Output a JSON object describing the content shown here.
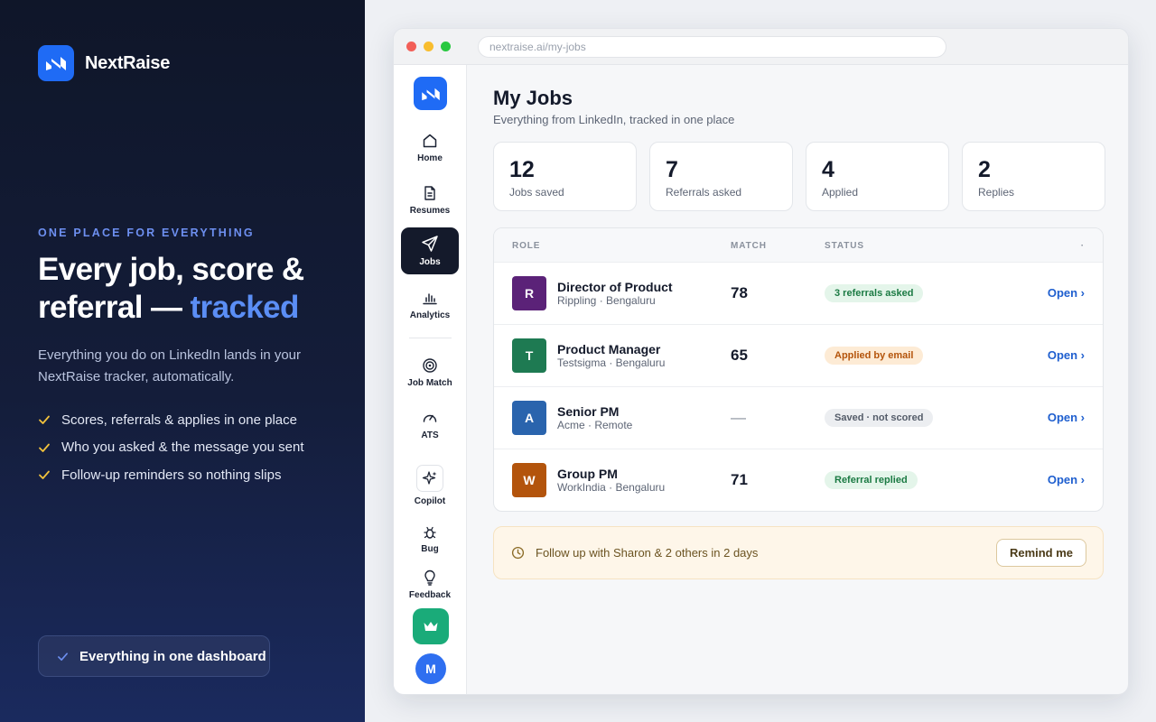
{
  "brand": {
    "name": "NextRaise"
  },
  "hero": {
    "eyebrow": "ONE PLACE FOR EVERYTHING",
    "headline_main": "Every job, score & referral — ",
    "headline_accent": "tracked",
    "lede": "Everything you do on LinkedIn lands in your NextRaise tracker, automatically.",
    "bullets": [
      "Scores, referrals & applies in one place",
      "Who you asked & the message you sent",
      "Follow-up reminders so nothing slips"
    ],
    "badge": "Everything in one dashboard"
  },
  "browser": {
    "url": "nextraise.ai/my-jobs"
  },
  "sidebar": {
    "items": [
      {
        "label": "Home",
        "icon": "home-icon"
      },
      {
        "label": "Resumes",
        "icon": "document-icon"
      },
      {
        "label": "Jobs",
        "icon": "send-icon",
        "active": true
      },
      {
        "label": "Analytics",
        "icon": "bar-chart-icon"
      },
      {
        "label": "Job Match",
        "icon": "target-icon"
      },
      {
        "label": "ATS",
        "icon": "gauge-icon"
      },
      {
        "label": "Copilot",
        "icon": "sparkle-icon"
      },
      {
        "label": "Bug",
        "icon": "bug-icon"
      },
      {
        "label": "Feedback",
        "icon": "lightbulb-icon"
      }
    ],
    "upgrade_icon": "crown-icon",
    "avatar_initial": "M"
  },
  "page": {
    "title": "My Jobs",
    "subtitle": "Everything from LinkedIn, tracked in one place"
  },
  "stats": [
    {
      "value": "12",
      "label": "Jobs saved"
    },
    {
      "value": "7",
      "label": "Referrals asked"
    },
    {
      "value": "4",
      "label": "Applied"
    },
    {
      "value": "2",
      "label": "Replies"
    }
  ],
  "table": {
    "headers": {
      "role": "ROLE",
      "match": "MATCH",
      "status": "STATUS",
      "action": "·"
    },
    "rows": [
      {
        "initial": "R",
        "logo_color": "#5b2278",
        "title": "Director of Product",
        "company": "Rippling · Bengaluru",
        "match": "78",
        "status": "3 referrals asked",
        "status_tone": "green",
        "action": "Open ›"
      },
      {
        "initial": "T",
        "logo_color": "#1e7a52",
        "title": "Product Manager",
        "company": "Testsigma · Bengaluru",
        "match": "65",
        "status": "Applied by email",
        "status_tone": "amber",
        "action": "Open ›"
      },
      {
        "initial": "A",
        "logo_color": "#2a64ad",
        "title": "Senior PM",
        "company": "Acme · Remote",
        "match": "—",
        "status": "Saved · not scored",
        "status_tone": "gray",
        "action": "Open ›"
      },
      {
        "initial": "W",
        "logo_color": "#b3540c",
        "title": "Group PM",
        "company": "WorkIndia · Bengaluru",
        "match": "71",
        "status": "Referral replied",
        "status_tone": "green",
        "action": "Open ›"
      }
    ]
  },
  "reminder": {
    "text": "Follow up with Sharon & 2 others in 2 days",
    "button": "Remind me"
  }
}
